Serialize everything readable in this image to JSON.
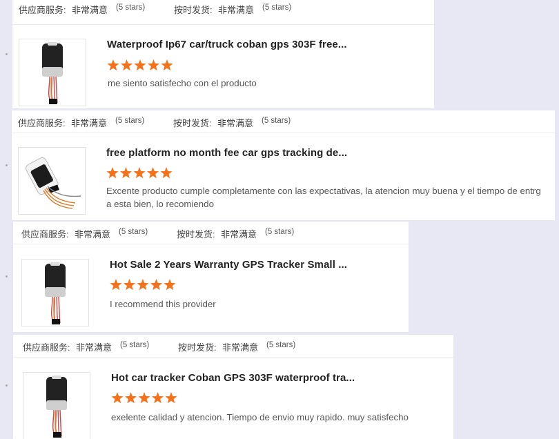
{
  "labels": {
    "supplier_service": "供应商服务:",
    "on_time_shipping": "按时发货:",
    "very_satisfied": "非常满意",
    "five_stars": "(5 stars)"
  },
  "colors": {
    "star": "#f5721a",
    "background": "#e8e8f4"
  },
  "reviews": [
    {
      "title": "Waterproof Ip67 car/truck coban gps 303F free...",
      "rating": 5,
      "comment": "me siento satisfecho con el producto",
      "image_icon": "gps-tracker-device-icon"
    },
    {
      "title": "free platform no month fee car gps tracking de...",
      "rating": 5,
      "comment": "Excente producto cumple completamente con las expectativas, la atencion muy buena y el tiempo de entrg a esta bien, lo recomiendo",
      "image_icon": "gps-tracker-device-icon"
    },
    {
      "title": "Hot Sale 2 Years Warranty GPS Tracker Small ...",
      "rating": 5,
      "comment": "I recommend this provider",
      "image_icon": "gps-tracker-device-icon"
    },
    {
      "title": "Hot car tracker Coban GPS 303F waterproof tra...",
      "rating": 5,
      "comment": "exelente calidad y atencion. Tiempo de envio muy rapido. muy satisfecho",
      "image_icon": "gps-tracker-device-icon"
    }
  ]
}
